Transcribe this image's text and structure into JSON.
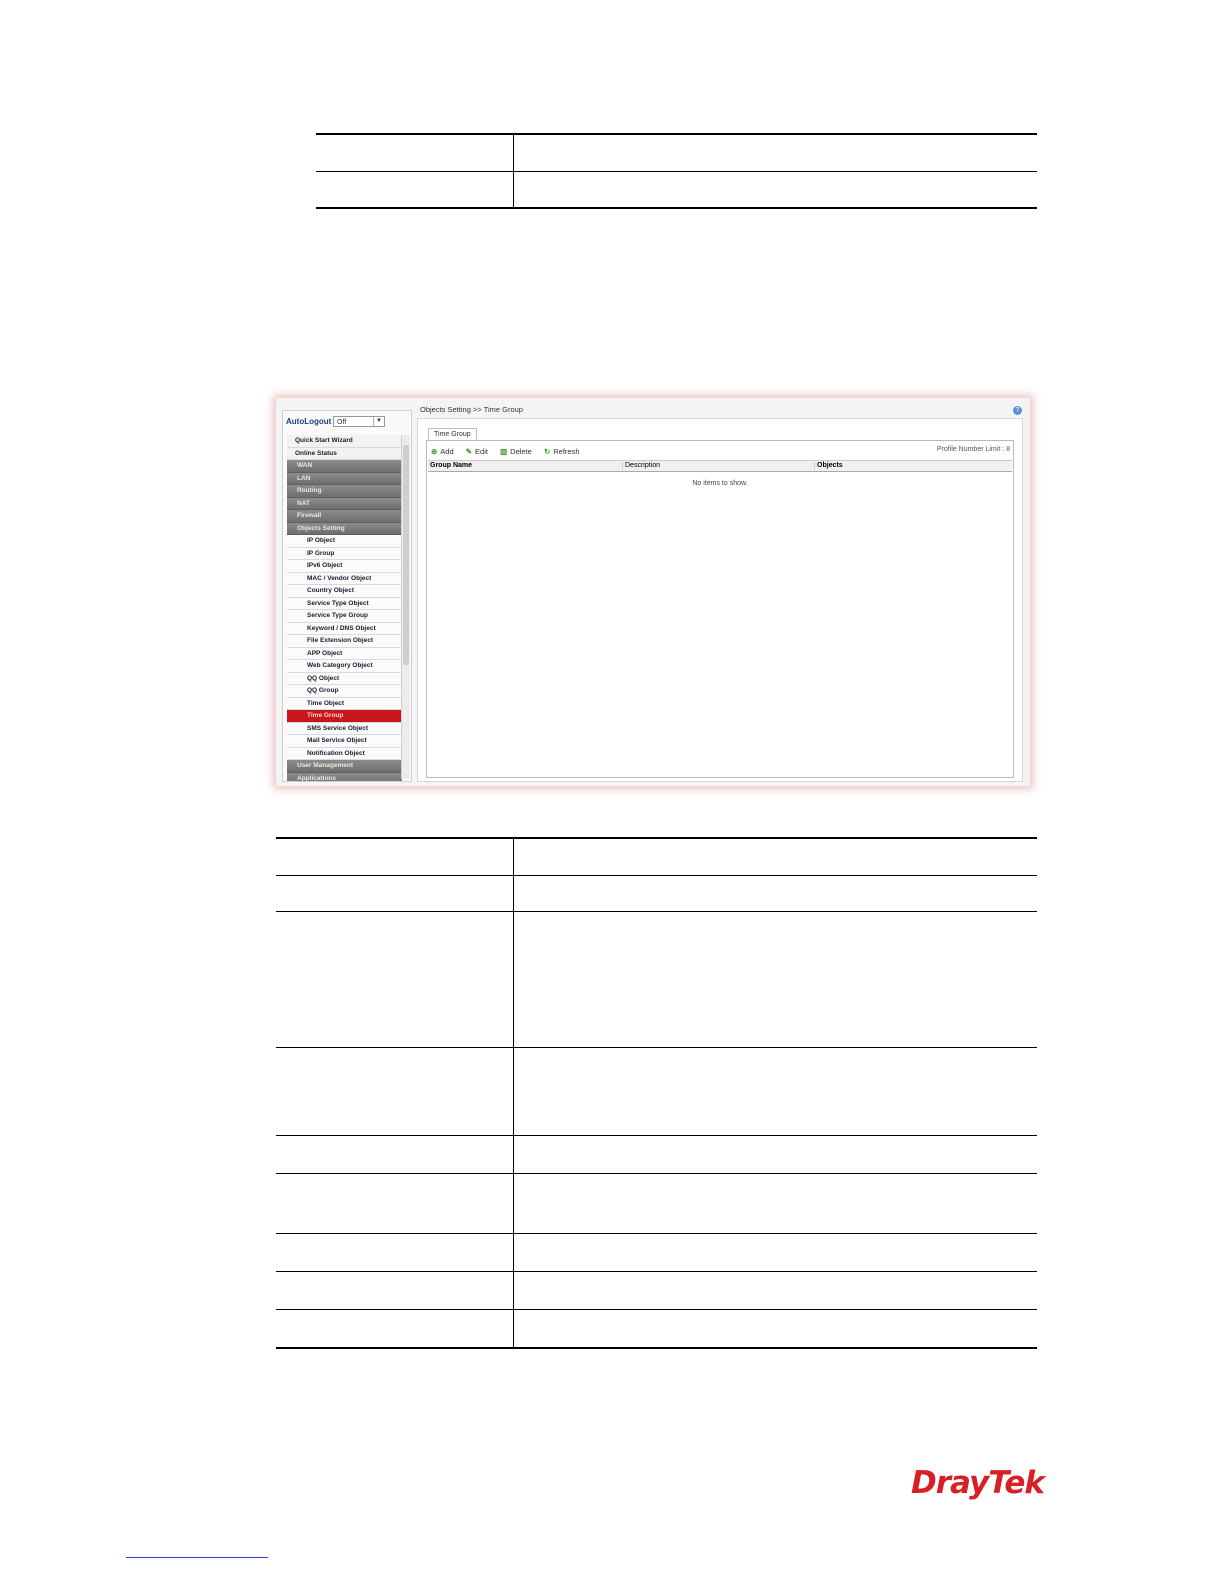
{
  "screenshot": {
    "breadcrumb": "Objects Setting >> Time Group",
    "auto_logout_label": "AutoLogout",
    "auto_logout_value": "Off",
    "tab": "Time Group",
    "toolbar": {
      "add": "Add",
      "edit": "Edit",
      "delete": "Delete",
      "refresh": "Refresh",
      "profile_limit": "Profile Number Limit : 8"
    },
    "grid": {
      "columns": [
        "Group Name",
        "Description",
        "Objects"
      ],
      "empty_message": "No items to show."
    },
    "menu": [
      {
        "label": "Quick Start Wizard",
        "kind": "top"
      },
      {
        "label": "Online Status",
        "kind": "top"
      },
      {
        "label": "WAN",
        "kind": "cat"
      },
      {
        "label": "LAN",
        "kind": "cat"
      },
      {
        "label": "Routing",
        "kind": "cat"
      },
      {
        "label": "NAT",
        "kind": "cat"
      },
      {
        "label": "Firewall",
        "kind": "cat"
      },
      {
        "label": "Objects Setting",
        "kind": "cat"
      },
      {
        "label": "IP Object",
        "kind": "sub"
      },
      {
        "label": "IP Group",
        "kind": "sub"
      },
      {
        "label": "IPv6 Object",
        "kind": "sub"
      },
      {
        "label": "MAC / Vendor Object",
        "kind": "sub"
      },
      {
        "label": "Country Object",
        "kind": "sub"
      },
      {
        "label": "Service Type Object",
        "kind": "sub"
      },
      {
        "label": "Service Type Group",
        "kind": "sub"
      },
      {
        "label": "Keyword / DNS Object",
        "kind": "sub"
      },
      {
        "label": "File Extension Object",
        "kind": "sub"
      },
      {
        "label": "APP Object",
        "kind": "sub"
      },
      {
        "label": "Web Category Object",
        "kind": "sub"
      },
      {
        "label": "QQ Object",
        "kind": "sub"
      },
      {
        "label": "QQ Group",
        "kind": "sub"
      },
      {
        "label": "Time Object",
        "kind": "sub"
      },
      {
        "label": "Time Group",
        "kind": "sub",
        "active": true
      },
      {
        "label": "SMS Service Object",
        "kind": "sub"
      },
      {
        "label": "Mail Service Object",
        "kind": "sub"
      },
      {
        "label": "Notification Object",
        "kind": "sub"
      },
      {
        "label": "User Management",
        "kind": "cat"
      },
      {
        "label": "Applications",
        "kind": "cat"
      }
    ]
  },
  "logo": "DrayTek",
  "brand_color": "#d91f26",
  "active_menu_color": "#c8161d"
}
